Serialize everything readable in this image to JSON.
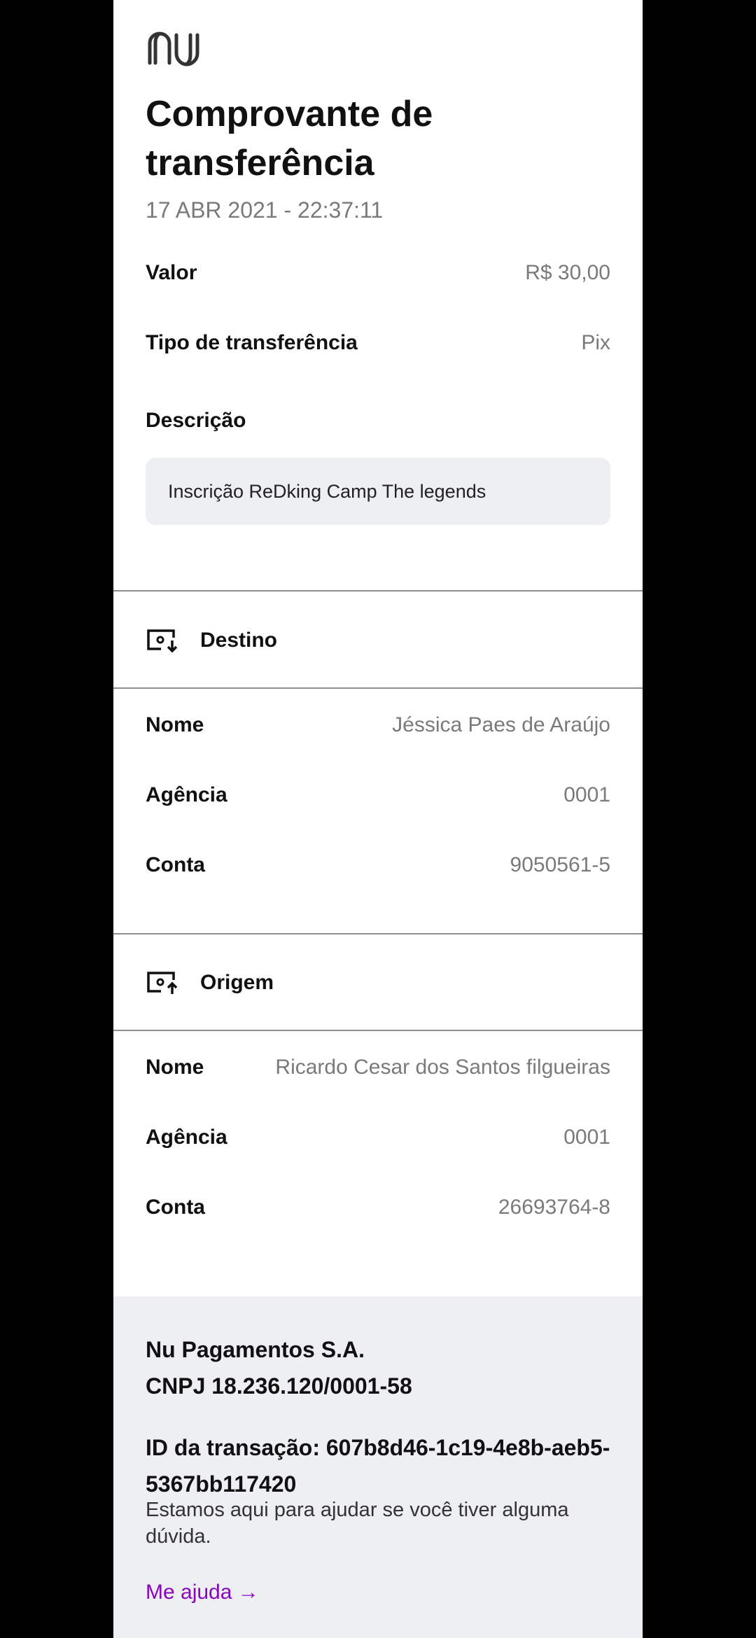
{
  "header": {
    "title_line1": "Comprovante de",
    "title_line2": "transferência",
    "timestamp": "17 ABR 2021 - 22:37:11"
  },
  "summary": {
    "valor_label": "Valor",
    "valor_value": "R$ 30,00",
    "tipo_label": "Tipo de transferência",
    "tipo_value": "Pix",
    "descricao_label": "Descrição",
    "descricao_value": "Inscrição ReDking Camp The legends"
  },
  "destino": {
    "title": "Destino",
    "icon": "account-incoming-icon",
    "nome_label": "Nome",
    "nome_value": "Jéssica Paes de Araújo",
    "agencia_label": "Agência",
    "agencia_value": "0001",
    "conta_label": "Conta",
    "conta_value": "9050561-5"
  },
  "origem": {
    "title": "Origem",
    "icon": "account-outgoing-icon",
    "nome_label": "Nome",
    "nome_value": "Ricardo Cesar dos Santos filgueiras",
    "agencia_label": "Agência",
    "agencia_value": "0001",
    "conta_label": "Conta",
    "conta_value": "26693764-8"
  },
  "footer": {
    "company_name": "Nu Pagamentos S.A.",
    "cnpj": "CNPJ 18.236.120/0001-58",
    "transaction_id": "ID da transação: 607b8d46-1c19-4e8b-aeb5-5367bb117420",
    "help_text": "Estamos aqui para ajudar se você tiver alguma dúvida.",
    "help_link": "Me ajuda →"
  },
  "colors": {
    "brand_purple": "#8a05be",
    "panel_gray": "#eeeff3",
    "divider": "#8e8e8e",
    "muted_text": "#7a7a7a"
  }
}
